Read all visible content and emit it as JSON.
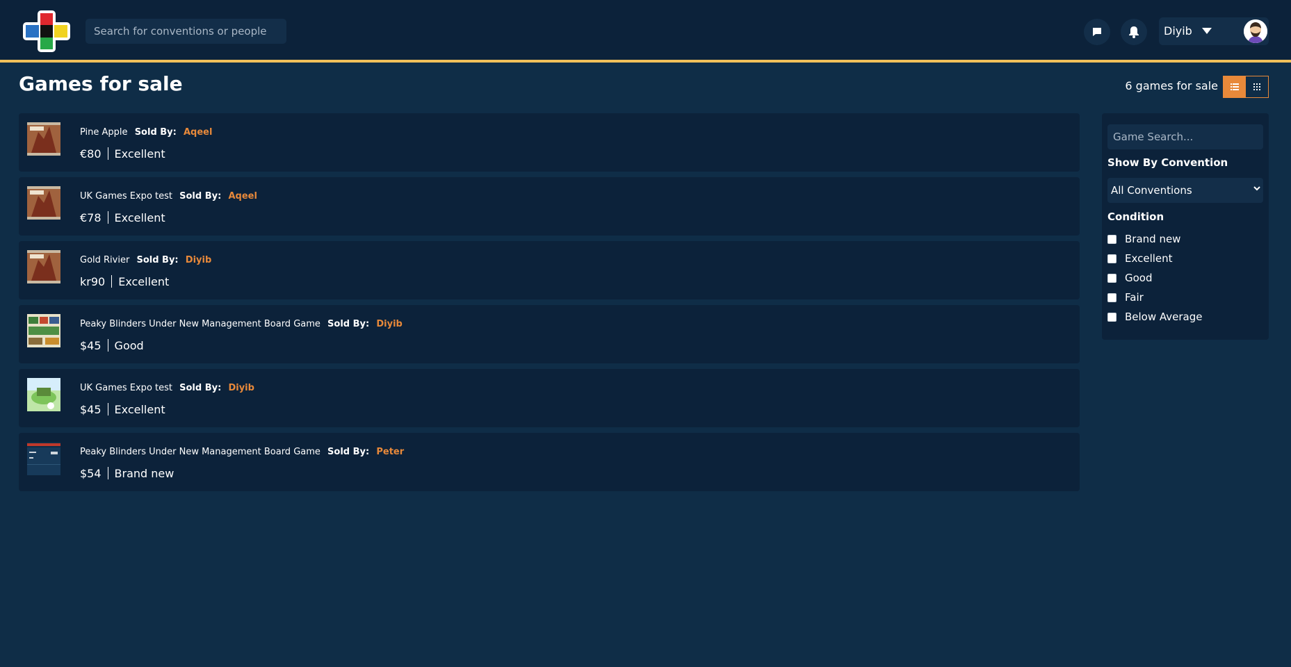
{
  "header": {
    "search_placeholder": "Search for conventions or people",
    "user_name": "Diyib"
  },
  "page": {
    "title": "Games for sale",
    "count_text": "6 games for sale"
  },
  "listings": [
    {
      "name": "Pine Apple",
      "sold_by_label": "Sold By:",
      "seller": "Aqeel",
      "price": "€80",
      "condition": "Excellent"
    },
    {
      "name": "UK Games Expo test",
      "sold_by_label": "Sold By:",
      "seller": "Aqeel",
      "price": "€78",
      "condition": "Excellent"
    },
    {
      "name": "Gold Rivier",
      "sold_by_label": "Sold By:",
      "seller": "Diyib",
      "price": "kr90",
      "condition": "Excellent"
    },
    {
      "name": "Peaky Blinders Under New Management Board Game",
      "sold_by_label": "Sold By:",
      "seller": "Diyib",
      "price": "$45",
      "condition": "Good"
    },
    {
      "name": "UK Games Expo test",
      "sold_by_label": "Sold By:",
      "seller": "Diyib",
      "price": "$45",
      "condition": "Excellent"
    },
    {
      "name": "Peaky Blinders Under New Management Board Game",
      "sold_by_label": "Sold By:",
      "seller": "Peter",
      "price": "$54",
      "condition": "Brand new"
    }
  ],
  "filters": {
    "search_placeholder": "Game Search...",
    "convention_label": "Show By Convention",
    "convention_selected": "All Conventions",
    "condition_label": "Condition",
    "conditions": [
      "Brand new",
      "Excellent",
      "Good",
      "Fair",
      "Below Average"
    ]
  },
  "colors": {
    "accent": "#e8893a",
    "header_border": "#f0c05a",
    "background": "#0f2d47",
    "panel": "#0c223a"
  }
}
